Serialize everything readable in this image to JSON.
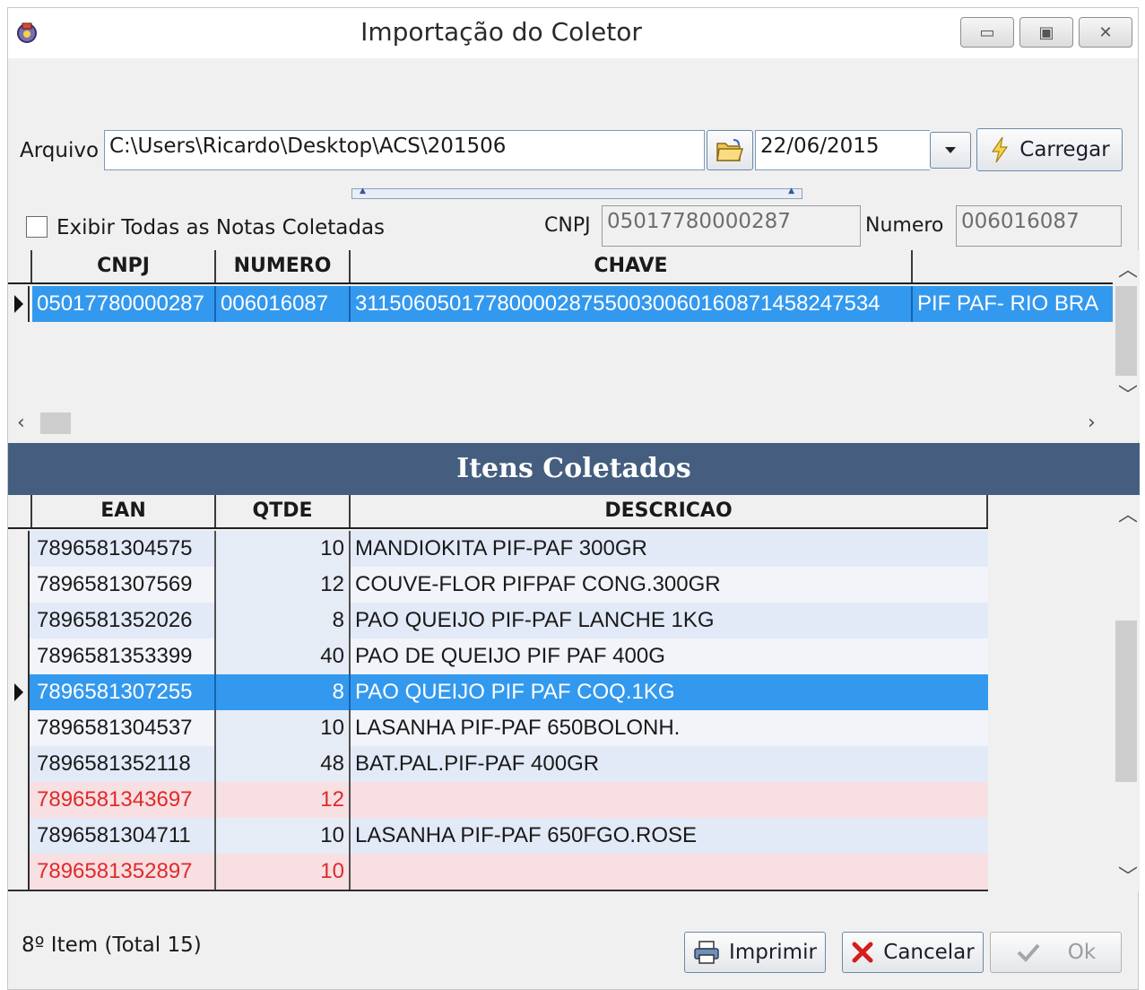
{
  "window": {
    "title": "Importação do Coletor"
  },
  "form": {
    "arquivo_label": "Arquivo",
    "arquivo_value": "C:\\Users\\Ricardo\\Desktop\\ACS\\201506",
    "date_value": "22/06/2015",
    "carregar_label": "Carregar",
    "exibir_label": "Exibir Todas as Notas Coletadas",
    "cnpj_label": "CNPJ",
    "cnpj_value": "05017780000287",
    "numero_label": "Numero",
    "numero_value": "006016087"
  },
  "notes_grid": {
    "columns": [
      "CNPJ",
      "NUMERO",
      "CHAVE"
    ],
    "rows": [
      {
        "cnpj": "05017780000287",
        "numero": "006016087",
        "chave": "31150605017780000287550030060160871458247534",
        "extra": "PIF PAF- RIO BRA"
      }
    ]
  },
  "section_title": "Itens Coletados",
  "items_grid": {
    "columns": [
      "EAN",
      "QTDE",
      "DESCRICAO"
    ],
    "rows": [
      {
        "ean": "7896581304575",
        "qtde": "10",
        "descricao": "MANDIOKITA PIF-PAF 300GR"
      },
      {
        "ean": "7896581307569",
        "qtde": "12",
        "descricao": "COUVE-FLOR PIFPAF CONG.300GR"
      },
      {
        "ean": "7896581352026",
        "qtde": "8",
        "descricao": "PAO QUEIJO PIF-PAF LANCHE 1KG"
      },
      {
        "ean": "7896581353399",
        "qtde": "40",
        "descricao": "PAO DE QUEIJO PIF PAF 400G"
      },
      {
        "ean": "7896581307255",
        "qtde": "8",
        "descricao": "PAO QUEIJO PIF PAF COQ.1KG"
      },
      {
        "ean": "7896581304537",
        "qtde": "10",
        "descricao": "LASANHA PIF-PAF 650BOLONH."
      },
      {
        "ean": "7896581352118",
        "qtde": "48",
        "descricao": "BAT.PAL.PIF-PAF 400GR"
      },
      {
        "ean": "7896581343697",
        "qtde": "12",
        "descricao": ""
      },
      {
        "ean": "7896581304711",
        "qtde": "10",
        "descricao": "LASANHA PIF-PAF 650FGO.ROSE"
      },
      {
        "ean": "7896581352897",
        "qtde": "10",
        "descricao": ""
      }
    ]
  },
  "status_text": "8º Item (Total 15)",
  "buttons": {
    "imprimir": "Imprimir",
    "cancelar": "Cancelar",
    "ok": "Ok"
  },
  "colors": {
    "selection": "#3399ee",
    "section_band": "#455e7f",
    "row_alt": "#e3eaf7",
    "row_plain": "#f2f4fa",
    "missing_row": "#f7dfe2",
    "missing_text": "#e02a2a",
    "qty_column": "#e6ecf6"
  },
  "icons": [
    "app-icon",
    "folder-open-icon",
    "chevron-down-icon",
    "lightning-icon",
    "printer-icon",
    "x-icon",
    "check-icon"
  ]
}
